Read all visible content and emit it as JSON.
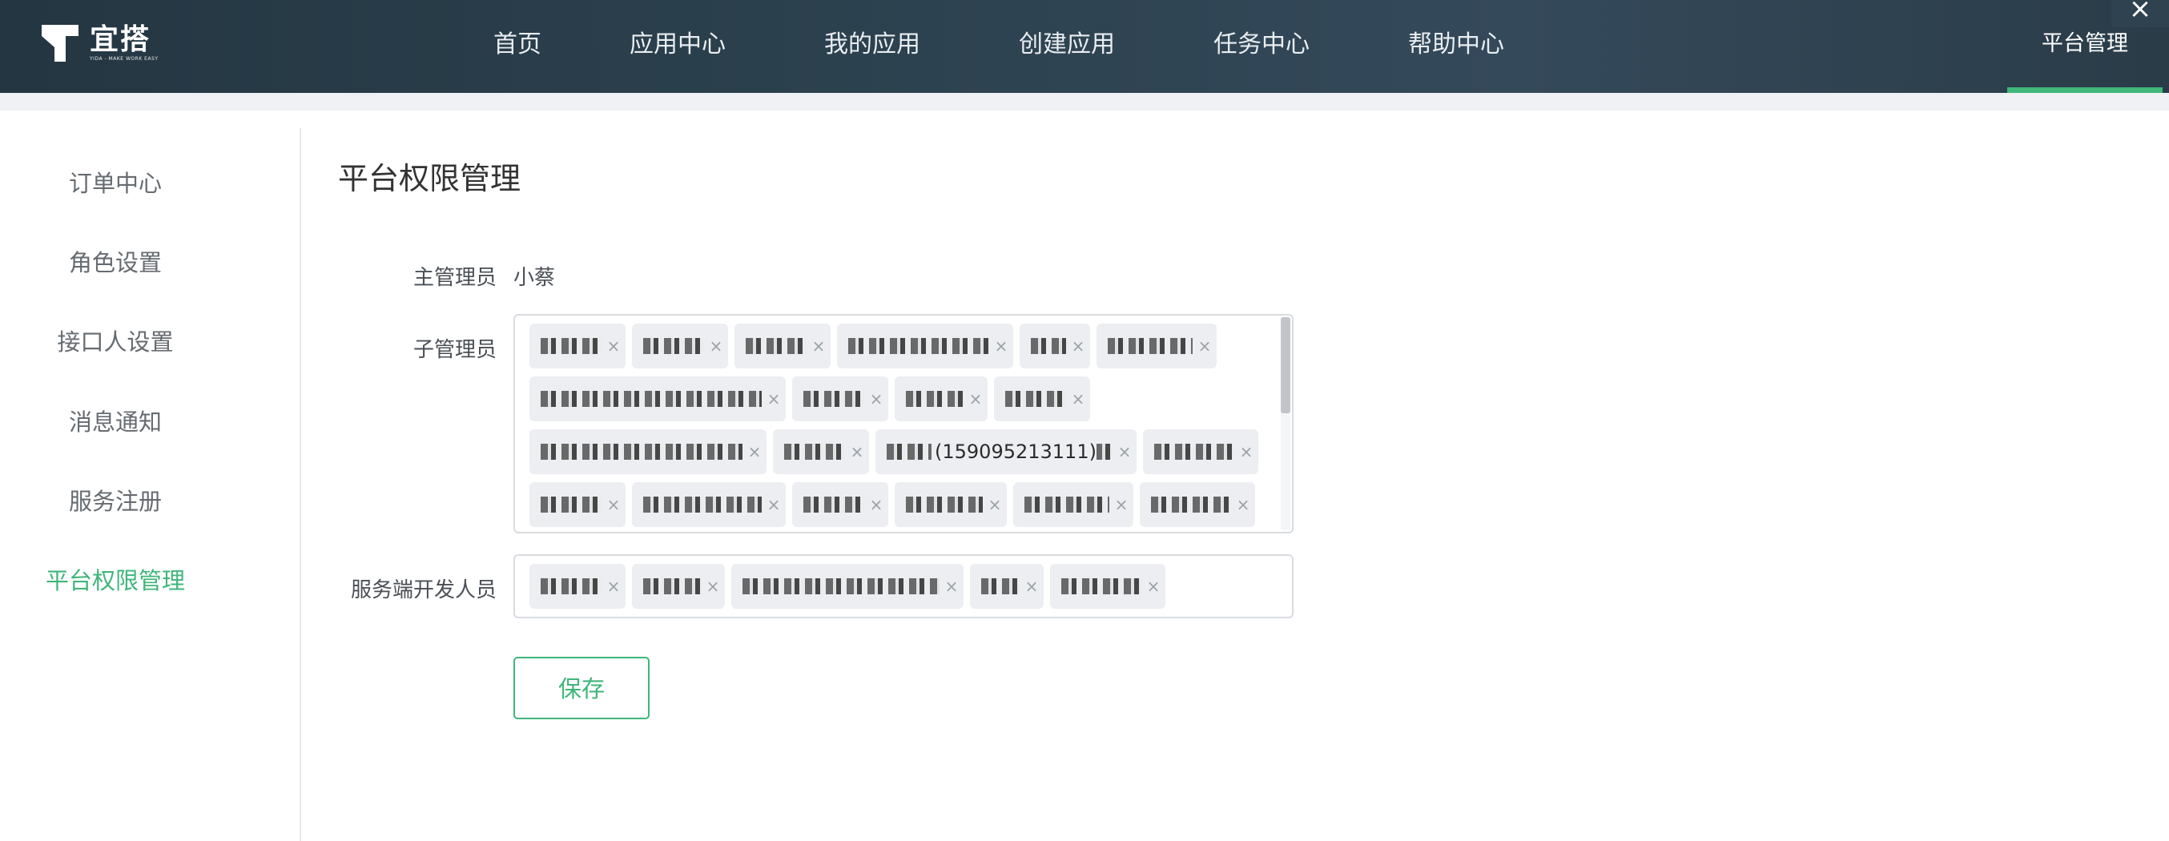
{
  "header": {
    "logo": {
      "name": "宜搭",
      "slogan": "YIDA - MAKE WORK EASY",
      "icon": "yida-logo-icon"
    },
    "nav": [
      {
        "label": "首页"
      },
      {
        "label": "应用中心"
      },
      {
        "label": "我的应用"
      },
      {
        "label": "创建应用"
      },
      {
        "label": "任务中心"
      },
      {
        "label": "帮助中心"
      }
    ],
    "right_nav": {
      "label": "平台管理",
      "active": true
    },
    "close_icon": "×",
    "accent_color": "#3fb67a"
  },
  "sidebar": {
    "items": [
      {
        "label": "订单中心",
        "active": false
      },
      {
        "label": "角色设置",
        "active": false
      },
      {
        "label": "接口人设置",
        "active": false
      },
      {
        "label": "消息通知",
        "active": false
      },
      {
        "label": "服务注册",
        "active": false
      },
      {
        "label": "平台权限管理",
        "active": true
      }
    ]
  },
  "main": {
    "title": "平台权限管理",
    "owner": {
      "label": "主管理员",
      "value": "小蔡"
    },
    "sub_admins": {
      "label": "子管理员",
      "visible_fragment": "(159095213111)",
      "tag_count": 21
    },
    "server_devs": {
      "label": "服务端开发人员",
      "tag_count": 5
    },
    "save_label": "保存"
  }
}
